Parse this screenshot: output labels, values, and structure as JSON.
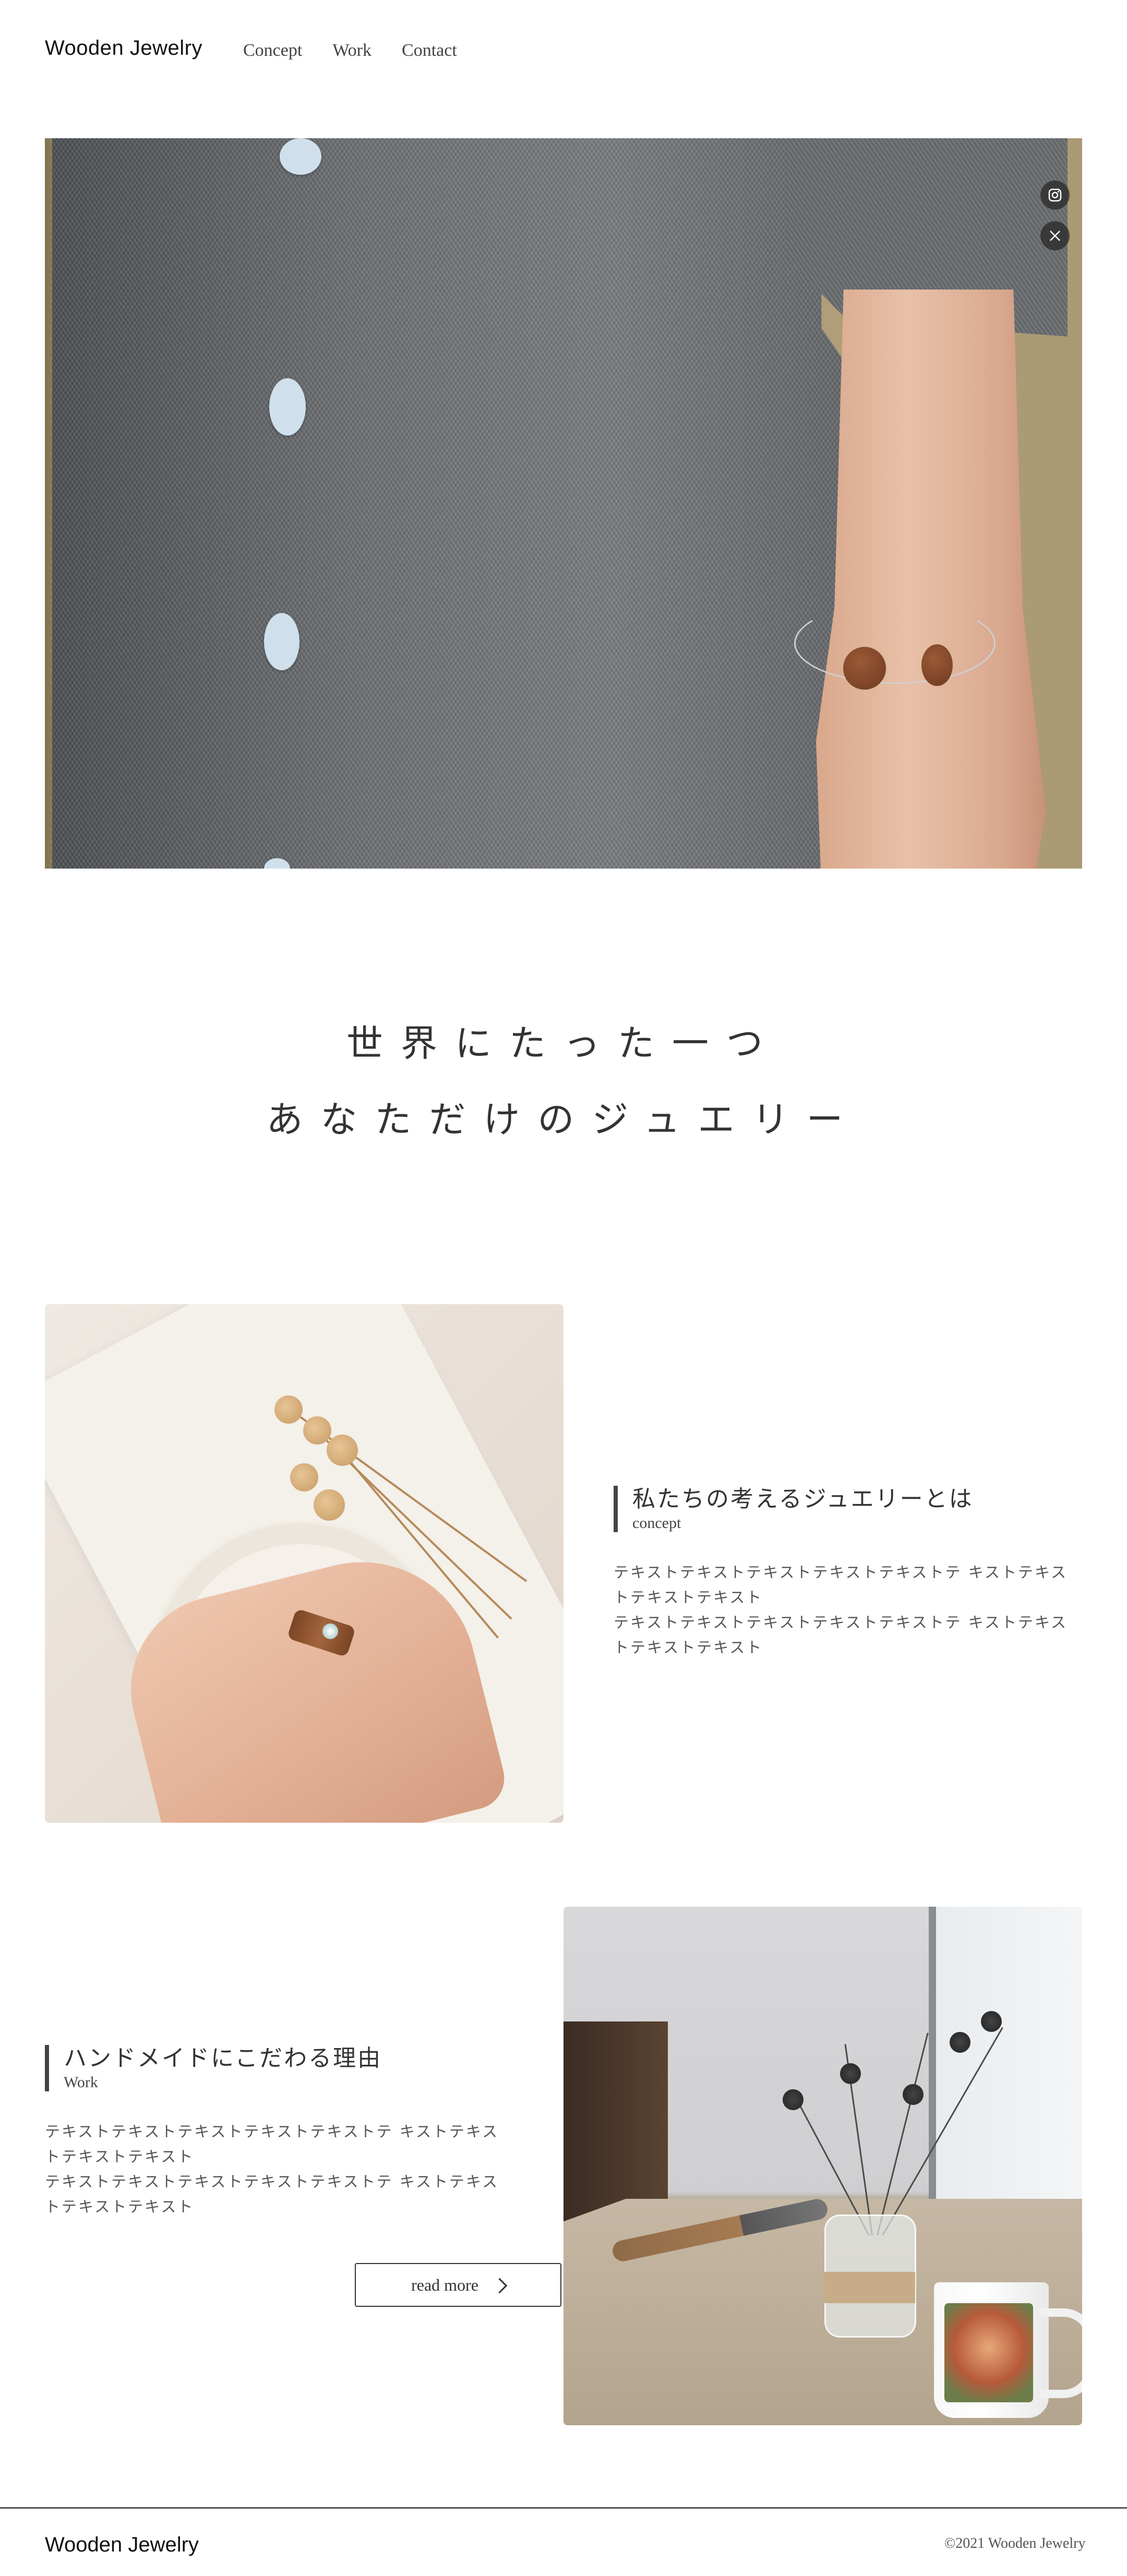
{
  "header": {
    "logo": "Wooden Jewelry",
    "nav": [
      "Concept",
      "Work",
      "Contact"
    ]
  },
  "hero": {
    "social": [
      "instagram-icon",
      "x-icon"
    ]
  },
  "catch": {
    "line1": "世界にたった一つ",
    "line2": "あなただけのジュエリー"
  },
  "concept": {
    "title": "私たちの考えるジュエリーとは",
    "subtitle": "concept",
    "body": "テキストテキストテキストテキストテキストテ キストテキストテキストテキスト\nテキストテキストテキストテキストテキストテ キストテキストテキストテキスト"
  },
  "work": {
    "title": "ハンドメイドにこだわる理由",
    "subtitle": "Work",
    "body": "テキストテキストテキストテキストテキストテ キストテキストテキストテキスト\nテキストテキストテキストテキストテキストテ キストテキストテキストテキスト",
    "button": "read more"
  },
  "footer": {
    "logo": "Wooden Jewelry",
    "copyright": "©2021 Wooden Jewelry"
  },
  "colors": {
    "text": "#333333",
    "accent_bar": "#444444",
    "background": "#ffffff"
  }
}
